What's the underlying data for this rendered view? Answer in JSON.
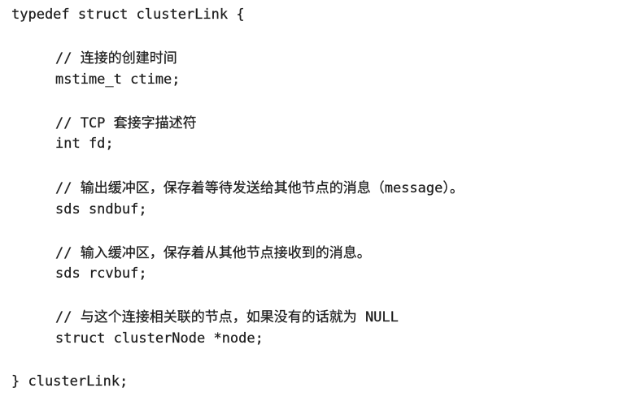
{
  "code": {
    "struct_open": "typedef struct clusterLink {",
    "comment_ctime": "// 连接的创建时间",
    "field_ctime": "mstime_t ctime;",
    "comment_fd": "// TCP 套接字描述符",
    "field_fd": "int fd;",
    "comment_sndbuf": "// 输出缓冲区，保存着等待发送给其他节点的消息（message）。",
    "field_sndbuf": "sds sndbuf;",
    "comment_rcvbuf": "// 输入缓冲区，保存着从其他节点接收到的消息。",
    "field_rcvbuf": "sds rcvbuf;",
    "comment_node": "// 与这个连接相关联的节点，如果没有的话就为 NULL",
    "field_node": "struct clusterNode *node;",
    "struct_close": "} clusterLink;"
  }
}
